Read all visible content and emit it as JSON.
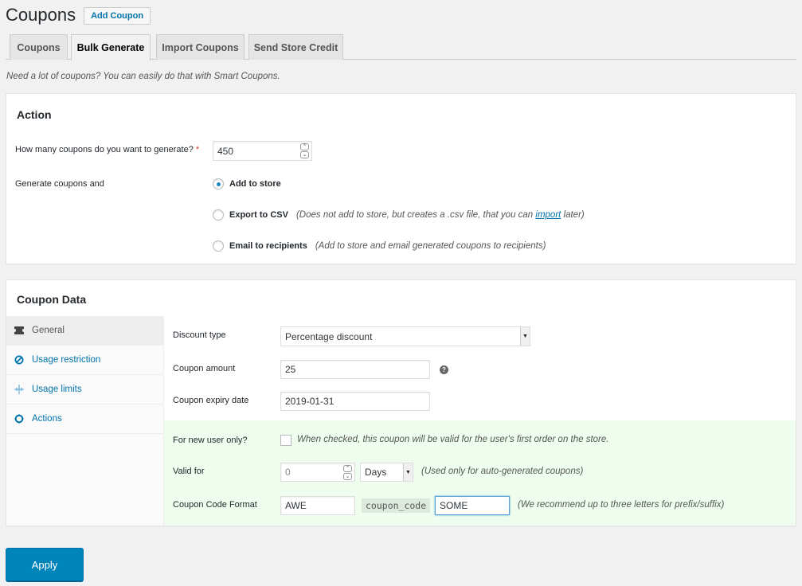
{
  "header": {
    "title": "Coupons",
    "add_button": "Add Coupon"
  },
  "tabs": [
    {
      "label": "Coupons",
      "active": false
    },
    {
      "label": "Bulk Generate",
      "active": true
    },
    {
      "label": "Import Coupons",
      "active": false
    },
    {
      "label": "Send Store Credit",
      "active": false
    }
  ],
  "tagline": "Need a lot of coupons? You can easily do that with Smart Coupons.",
  "action_panel": {
    "title": "Action",
    "quantity_label": "How many coupons do you want to generate?",
    "required_mark": "*",
    "quantity_value": "450",
    "generate_label": "Generate coupons and",
    "options": [
      {
        "label": "Add to store",
        "desc": "",
        "selected": true
      },
      {
        "label": "Export to CSV",
        "desc_before": "(Does not add to store, but creates a .csv file, that you can ",
        "desc_link": "import",
        "desc_after": " later)",
        "selected": false
      },
      {
        "label": "Email to recipients",
        "desc": "(Add to store and email generated coupons to recipients)",
        "selected": false
      }
    ]
  },
  "coupon_data": {
    "title": "Coupon Data",
    "sidebar": [
      {
        "label": "General",
        "icon": "ticket-icon",
        "active": true
      },
      {
        "label": "Usage restriction",
        "icon": "block-icon",
        "active": false
      },
      {
        "label": "Usage limits",
        "icon": "limits-icon",
        "active": false
      },
      {
        "label": "Actions",
        "icon": "gear-icon",
        "active": false
      }
    ],
    "fields": {
      "discount_type_label": "Discount type",
      "discount_type_value": "Percentage discount",
      "amount_label": "Coupon amount",
      "amount_value": "25",
      "help_glyph": "?",
      "expiry_label": "Coupon expiry date",
      "expiry_value": "2019-01-31",
      "new_user_label": "For new user only?",
      "new_user_checked": false,
      "new_user_desc": "When checked, this coupon will be valid for the user's first order on the store.",
      "valid_for_label": "Valid for",
      "valid_for_value": "0",
      "valid_for_unit": "Days",
      "valid_for_note": "(Used only for auto-generated coupons)",
      "code_format_label": "Coupon Code Format",
      "prefix_value": "AWE",
      "code_placeholder": "coupon_code",
      "suffix_value": "SOME",
      "code_format_note": "(We recommend up to three letters for prefix/suffix)"
    }
  },
  "apply_button": "Apply",
  "colors": {
    "accent": "#0073aa",
    "primary_button": "#0085ba",
    "required": "#dc3232",
    "highlight_bg": "#eefdee"
  }
}
